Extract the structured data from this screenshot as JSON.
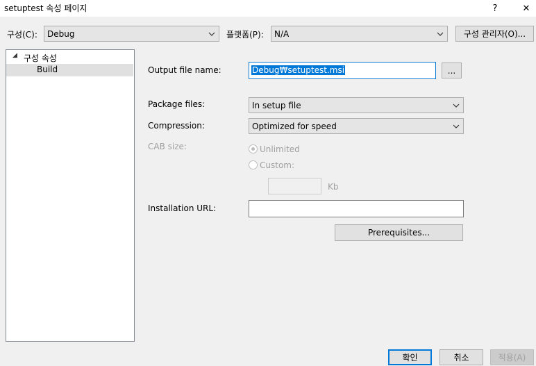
{
  "window": {
    "title": "setuptest 속성 페이지",
    "help_label": "?",
    "close_label": "✕"
  },
  "toolbar": {
    "config_label": "구성(C):",
    "config_value": "Debug",
    "platform_label": "플랫폼(P):",
    "platform_value": "N/A",
    "config_manager_label": "구성 관리자(O)..."
  },
  "tree": {
    "root_label": "구성 속성",
    "expand_glyph": "◢",
    "child_label": "Build"
  },
  "form": {
    "output_label": "Output file name:",
    "output_value": "Debug₩setuptest.msi",
    "browse_label": "...",
    "package_label": "Package files:",
    "package_value": "In setup file",
    "compression_label": "Compression:",
    "compression_value": "Optimized for speed",
    "cab_label": "CAB size:",
    "unlimited_label": "Unlimited",
    "custom_label": "Custom:",
    "custom_value": "",
    "kb_label": "Kb",
    "install_url_label": "Installation URL:",
    "install_url_value": "",
    "prereq_label": "Prerequisites..."
  },
  "footer": {
    "ok_label": "확인",
    "cancel_label": "취소",
    "apply_label": "적용(A)"
  },
  "icons": {
    "chevron": "chevron-down-icon",
    "help": "help-icon",
    "close": "close-icon"
  },
  "colors": {
    "selection": "#0078d7",
    "tree_selected": "#e0e0e0",
    "ok_border": "#0078d7"
  }
}
